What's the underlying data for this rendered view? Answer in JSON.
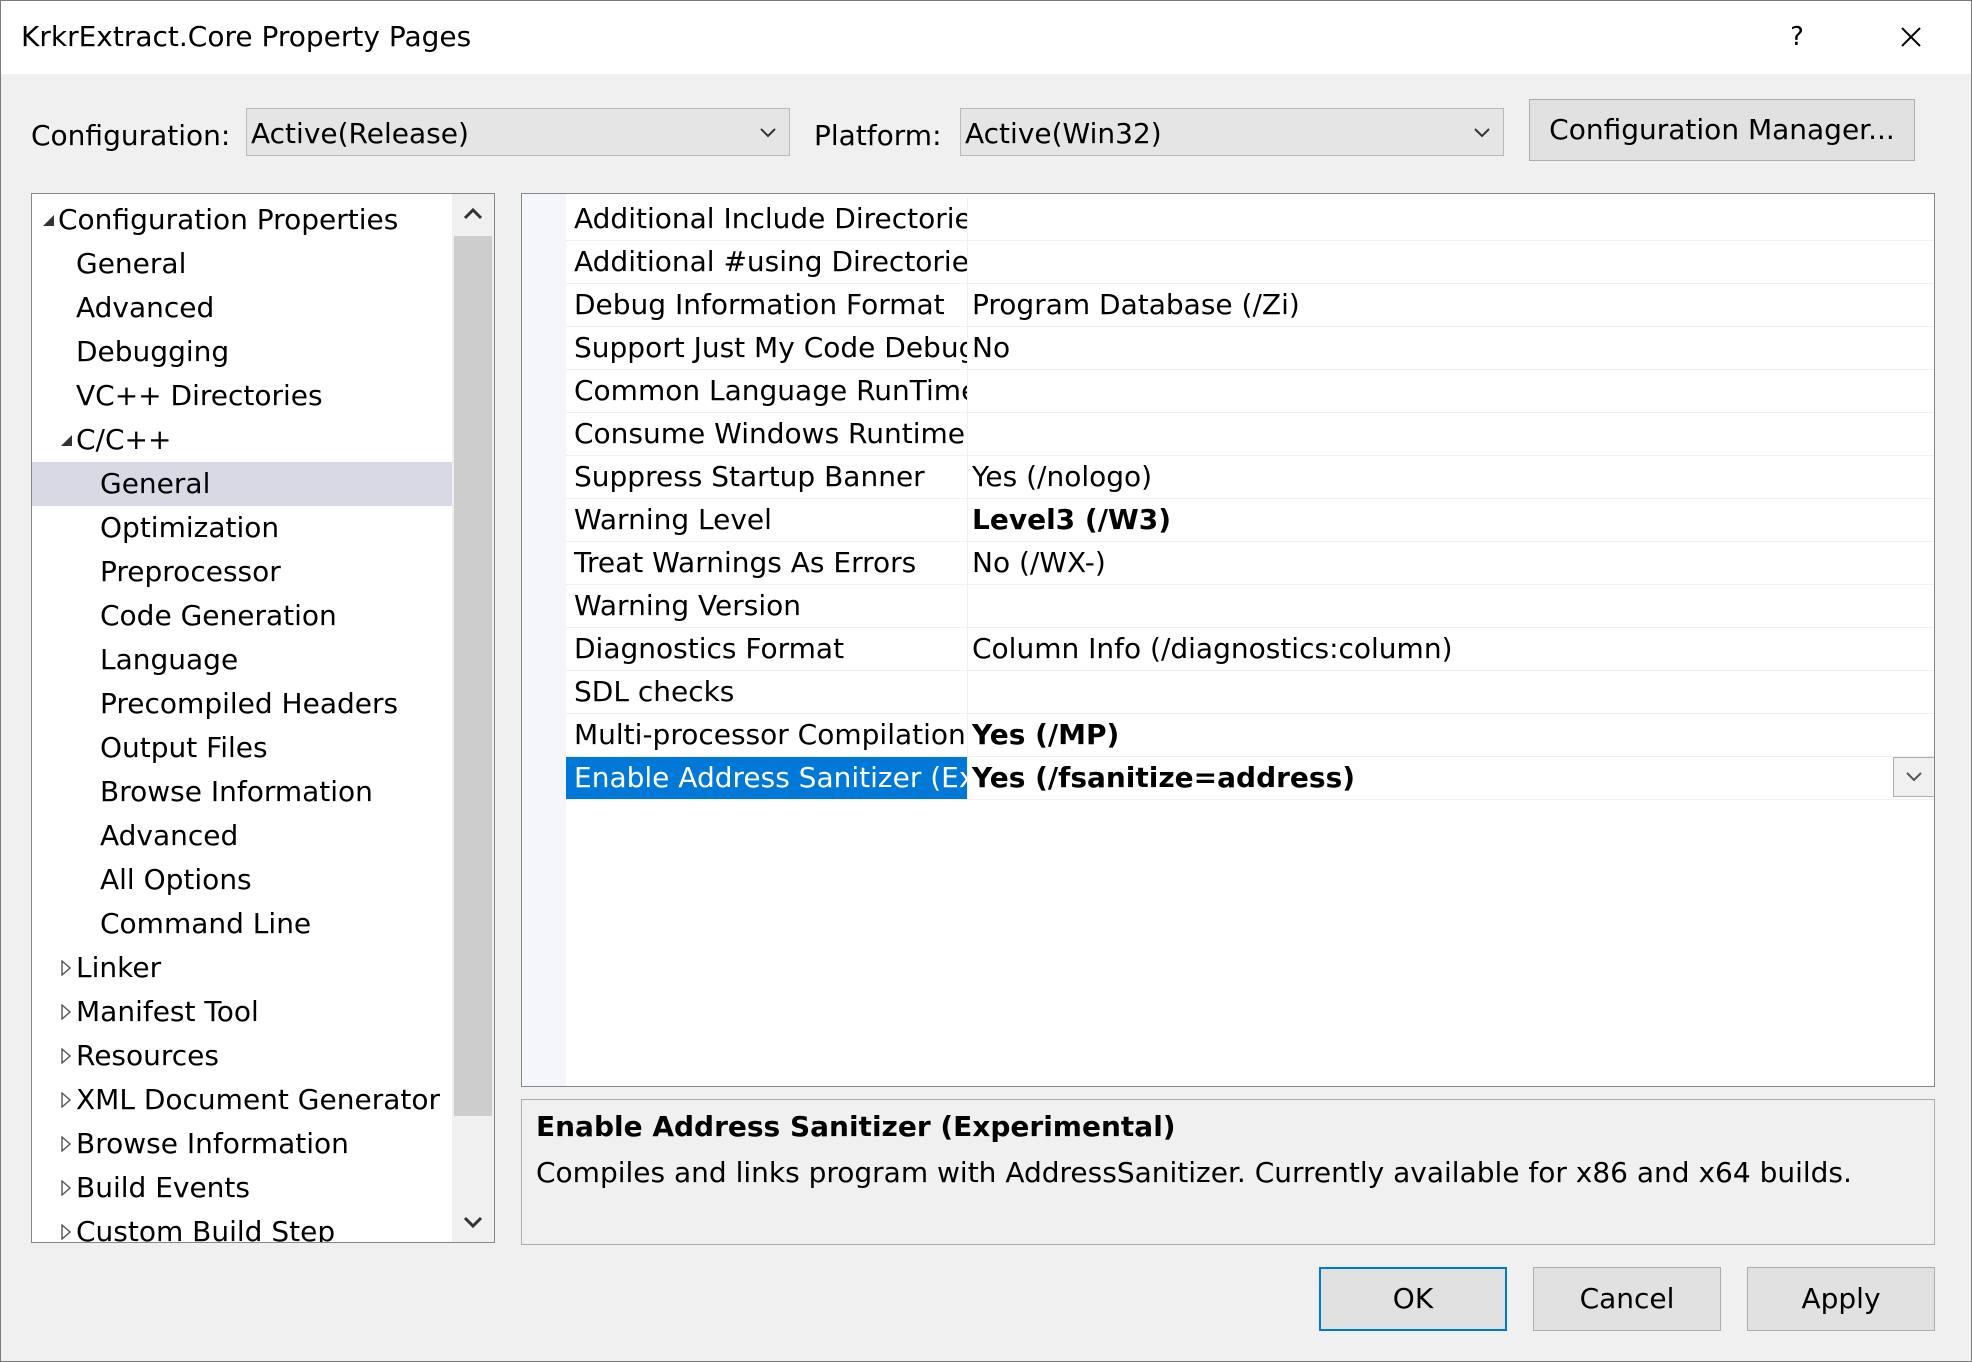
{
  "window": {
    "title": "KrkrExtract.Core Property Pages",
    "help": "?"
  },
  "config": {
    "label": "Configuration:",
    "value": "Active(Release)",
    "platform_label": "Platform:",
    "platform_value": "Active(Win32)",
    "manager_button": "Configuration Manager..."
  },
  "tree": {
    "items": [
      {
        "label": "Configuration Properties",
        "level": 0,
        "expander": "expanded"
      },
      {
        "label": "General",
        "level": 1,
        "expander": "none"
      },
      {
        "label": "Advanced",
        "level": 1,
        "expander": "none"
      },
      {
        "label": "Debugging",
        "level": 1,
        "expander": "none"
      },
      {
        "label": "VC++ Directories",
        "level": 1,
        "expander": "none"
      },
      {
        "label": "C/C++",
        "level": 1,
        "expander": "expanded"
      },
      {
        "label": "General",
        "level": 2,
        "expander": "none",
        "selected": true
      },
      {
        "label": "Optimization",
        "level": 2,
        "expander": "none"
      },
      {
        "label": "Preprocessor",
        "level": 2,
        "expander": "none"
      },
      {
        "label": "Code Generation",
        "level": 2,
        "expander": "none"
      },
      {
        "label": "Language",
        "level": 2,
        "expander": "none"
      },
      {
        "label": "Precompiled Headers",
        "level": 2,
        "expander": "none"
      },
      {
        "label": "Output Files",
        "level": 2,
        "expander": "none"
      },
      {
        "label": "Browse Information",
        "level": 2,
        "expander": "none"
      },
      {
        "label": "Advanced",
        "level": 2,
        "expander": "none"
      },
      {
        "label": "All Options",
        "level": 2,
        "expander": "none"
      },
      {
        "label": "Command Line",
        "level": 2,
        "expander": "none"
      },
      {
        "label": "Linker",
        "level": 1,
        "expander": "collapsed"
      },
      {
        "label": "Manifest Tool",
        "level": 1,
        "expander": "collapsed"
      },
      {
        "label": "Resources",
        "level": 1,
        "expander": "collapsed"
      },
      {
        "label": "XML Document Generator",
        "level": 1,
        "expander": "collapsed"
      },
      {
        "label": "Browse Information",
        "level": 1,
        "expander": "collapsed"
      },
      {
        "label": "Build Events",
        "level": 1,
        "expander": "collapsed"
      },
      {
        "label": "Custom Build Step",
        "level": 1,
        "expander": "collapsed"
      }
    ]
  },
  "grid": {
    "rows": [
      {
        "name": "Additional Include Directories",
        "value": "",
        "bold": false
      },
      {
        "name": "Additional #using Directories",
        "value": "",
        "bold": false
      },
      {
        "name": "Debug Information Format",
        "value": "Program Database (/Zi)",
        "bold": false
      },
      {
        "name": "Support Just My Code Debugging",
        "value": "No",
        "bold": false
      },
      {
        "name": "Common Language RunTime Support",
        "value": "",
        "bold": false
      },
      {
        "name": "Consume Windows Runtime Extension",
        "value": "",
        "bold": false
      },
      {
        "name": "Suppress Startup Banner",
        "value": "Yes (/nologo)",
        "bold": false
      },
      {
        "name": "Warning Level",
        "value": "Level3 (/W3)",
        "bold": true
      },
      {
        "name": "Treat Warnings As Errors",
        "value": "No (/WX-)",
        "bold": false
      },
      {
        "name": "Warning Version",
        "value": "",
        "bold": false
      },
      {
        "name": "Diagnostics Format",
        "value": "Column Info (/diagnostics:column)",
        "bold": false
      },
      {
        "name": "SDL checks",
        "value": "",
        "bold": false
      },
      {
        "name": "Multi-processor Compilation",
        "value": "Yes (/MP)",
        "bold": true
      },
      {
        "name": "Enable Address Sanitizer (Experimental)",
        "value": "Yes (/fsanitize=address)",
        "bold": true,
        "selected": true
      }
    ]
  },
  "description": {
    "title": "Enable Address Sanitizer (Experimental)",
    "text": "Compiles and links program with AddressSanitizer. Currently available for x86 and x64 builds."
  },
  "buttons": {
    "ok": "OK",
    "cancel": "Cancel",
    "apply": "Apply"
  },
  "colors": {
    "selection": "#0078d7",
    "tree_selection": "#d9d9e6"
  }
}
